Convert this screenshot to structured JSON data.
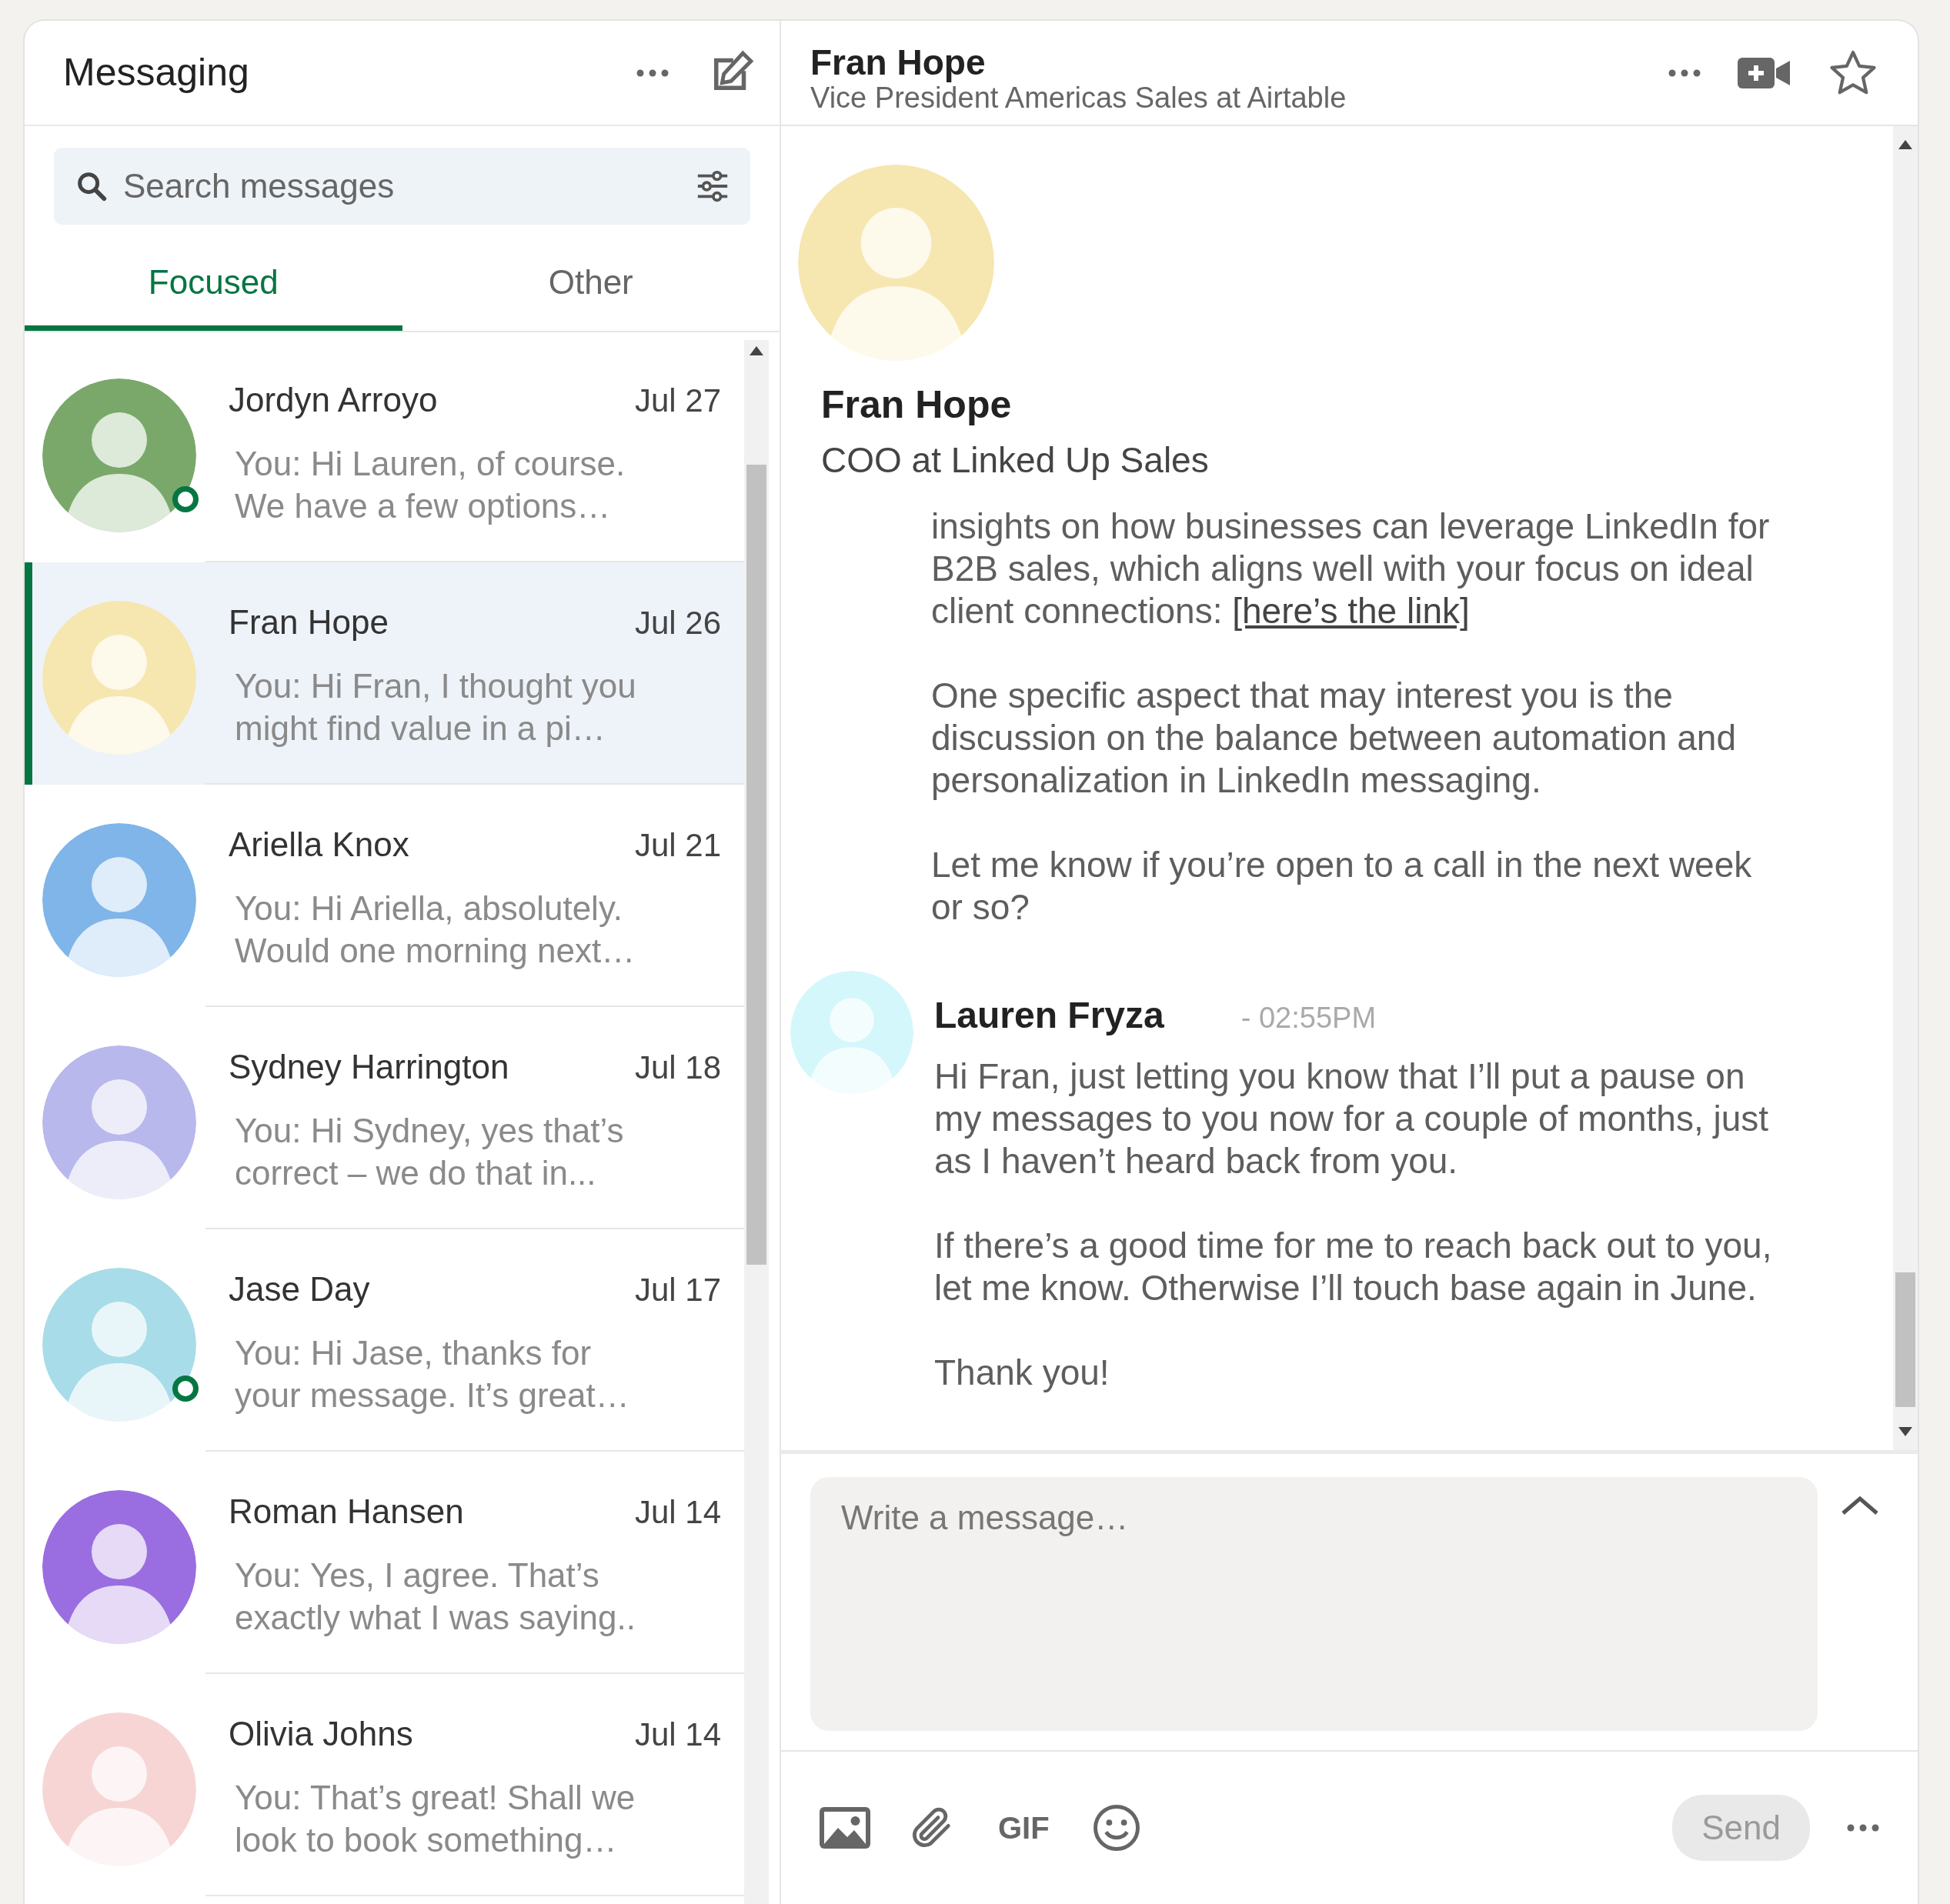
{
  "header": {
    "title": "Messaging"
  },
  "search": {
    "placeholder": "Search messages"
  },
  "tabs": [
    {
      "label": "Focused",
      "selected": true
    },
    {
      "label": "Other",
      "selected": false
    }
  ],
  "conversations": [
    {
      "name": "Jordyn Arroyo",
      "date": "Jul 27",
      "preview": [
        "You: Hi Lauren, of course.",
        "We have a few options…"
      ],
      "selected": false,
      "online": true
    },
    {
      "name": "Fran Hope",
      "date": "Jul 26",
      "preview": [
        "You: Hi Fran, I thought you",
        "might find value in a pi…"
      ],
      "selected": true,
      "online": false
    },
    {
      "name": "Ariella Knox",
      "date": "Jul 21",
      "preview": [
        "You: Hi Ariella, absolutely.",
        "Would one morning next…"
      ],
      "selected": false,
      "online": false
    },
    {
      "name": "Sydney Harrington",
      "date": "Jul 18",
      "preview": [
        "You: Hi Sydney, yes that’s",
        "correct – we do that in..."
      ],
      "selected": false,
      "online": false
    },
    {
      "name": "Jase Day",
      "date": "Jul 17",
      "preview": [
        "You: Hi Jase, thanks for",
        "your message. It’s great…"
      ],
      "selected": false,
      "online": true
    },
    {
      "name": "Roman Hansen",
      "date": "Jul 14",
      "preview": [
        "You: Yes, I agree. That’s",
        "exactly what I was saying.."
      ],
      "selected": false,
      "online": false
    },
    {
      "name": "Olivia Johns",
      "date": "Jul 14",
      "preview": [
        "You: That’s great! Shall we",
        "look to book something…"
      ],
      "selected": false,
      "online": false
    }
  ],
  "chat": {
    "contact": {
      "name": "Fran Hope",
      "headline": "Vice President Americas Sales at Airtable"
    },
    "profile": {
      "name": "Fran Hope",
      "headline": "COO at Linked Up Sales"
    },
    "messages": [
      {
        "paragraphs": [
          {
            "text": "insights on how businesses can leverage LinkedIn for B2B sales, which aligns well with your focus on ideal client connections: ",
            "link": "[here’s the link]"
          },
          {
            "text": "One specific aspect that may interest you is the discussion on the balance between automation and personalization in LinkedIn messaging."
          },
          {
            "text": "Let me know if you’re open to a call in the next week or so?"
          }
        ]
      },
      {
        "sender": "Lauren Fryza",
        "time": "- 02:55PM",
        "paragraphs": [
          {
            "text": "Hi Fran, just letting you know that I’ll put a pause on my messages to you now for a couple of months, just as I haven’t heard back from you."
          },
          {
            "text": "If there’s a good time for me to reach back out to you, let me know. Otherwise I’ll touch base again in June."
          },
          {
            "text": "Thank you!"
          }
        ]
      }
    ]
  },
  "composer": {
    "placeholder": "Write a message…",
    "gif": "GIF",
    "send": {
      "label": "Send",
      "disabled": true
    }
  }
}
